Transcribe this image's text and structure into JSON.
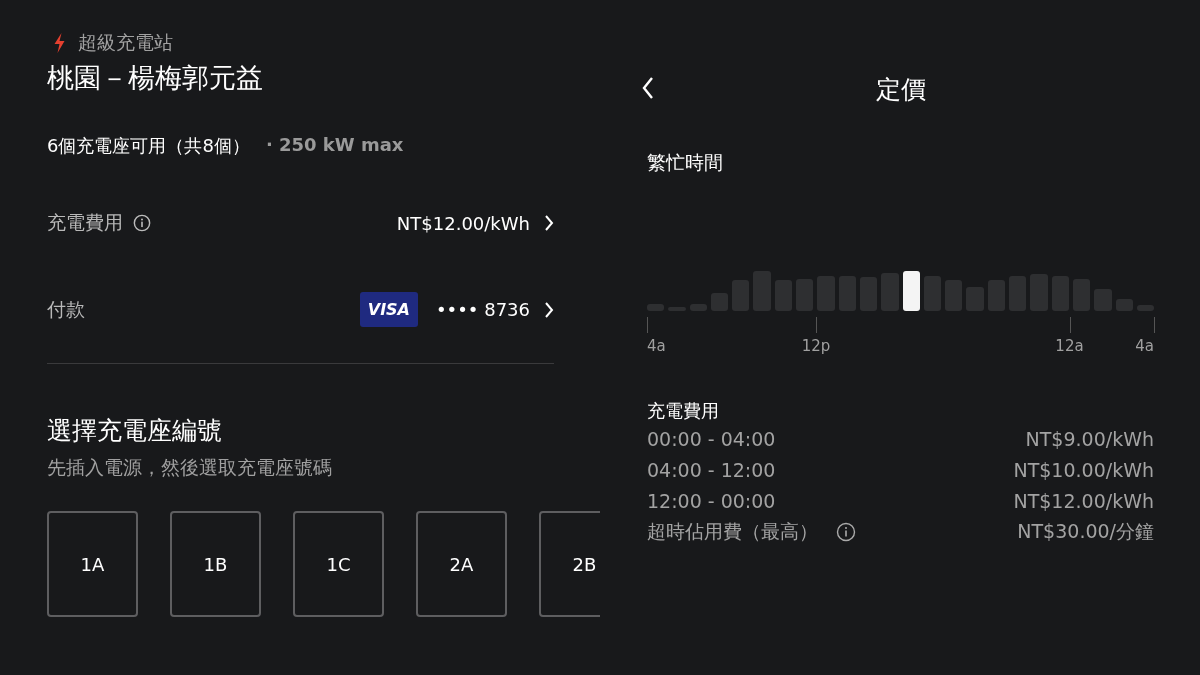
{
  "station": {
    "category": "超級充電站",
    "name": "桃園－楊梅郭元益",
    "availability": "6個充電座可用（共8個）",
    "max_power": "· 250 kW max"
  },
  "fee_row": {
    "label": "充電費用",
    "value": "NT$12.00/kWh"
  },
  "payment_row": {
    "label": "付款",
    "card_brand": "VISA",
    "card_number": "•••• 8736"
  },
  "stall_section": {
    "title": "選擇充電座編號",
    "subtitle": "先插入電源，然後選取充電座號碼",
    "stalls": [
      "1A",
      "1B",
      "1C",
      "2A",
      "2B"
    ]
  },
  "pricing": {
    "title": "定價",
    "busy_title": "繁忙時間",
    "bars": [
      {
        "selected": false
      },
      {
        "selected": false
      },
      {
        "selected": false
      },
      {
        "selected": false
      },
      {
        "selected": false
      },
      {
        "selected": false
      },
      {
        "selected": false
      },
      {
        "selected": false
      },
      {
        "selected": false
      },
      {
        "selected": false
      },
      {
        "selected": false
      },
      {
        "selected": false
      },
      {
        "selected": true
      },
      {
        "selected": false
      },
      {
        "selected": false
      },
      {
        "selected": false
      },
      {
        "selected": false
      },
      {
        "selected": false
      },
      {
        "selected": false
      },
      {
        "selected": false
      },
      {
        "selected": false
      },
      {
        "selected": false
      },
      {
        "selected": false
      },
      {
        "selected": false
      }
    ],
    "ticks": [
      "4a",
      "12p",
      "12a",
      "4a"
    ],
    "fees_title": "充電費用",
    "fees": [
      {
        "label": "00:00 - 04:00",
        "value": "NT$9.00/kWh",
        "kind": "rate"
      },
      {
        "label": "04:00 - 12:00",
        "value": "NT$10.00/kWh",
        "kind": "rate"
      },
      {
        "label": "12:00 - 00:00",
        "value": "NT$12.00/kWh",
        "kind": "rate"
      },
      {
        "label": "超時佔用費（最高）",
        "value": "NT$30.00/分鐘",
        "kind": "info"
      }
    ]
  }
}
